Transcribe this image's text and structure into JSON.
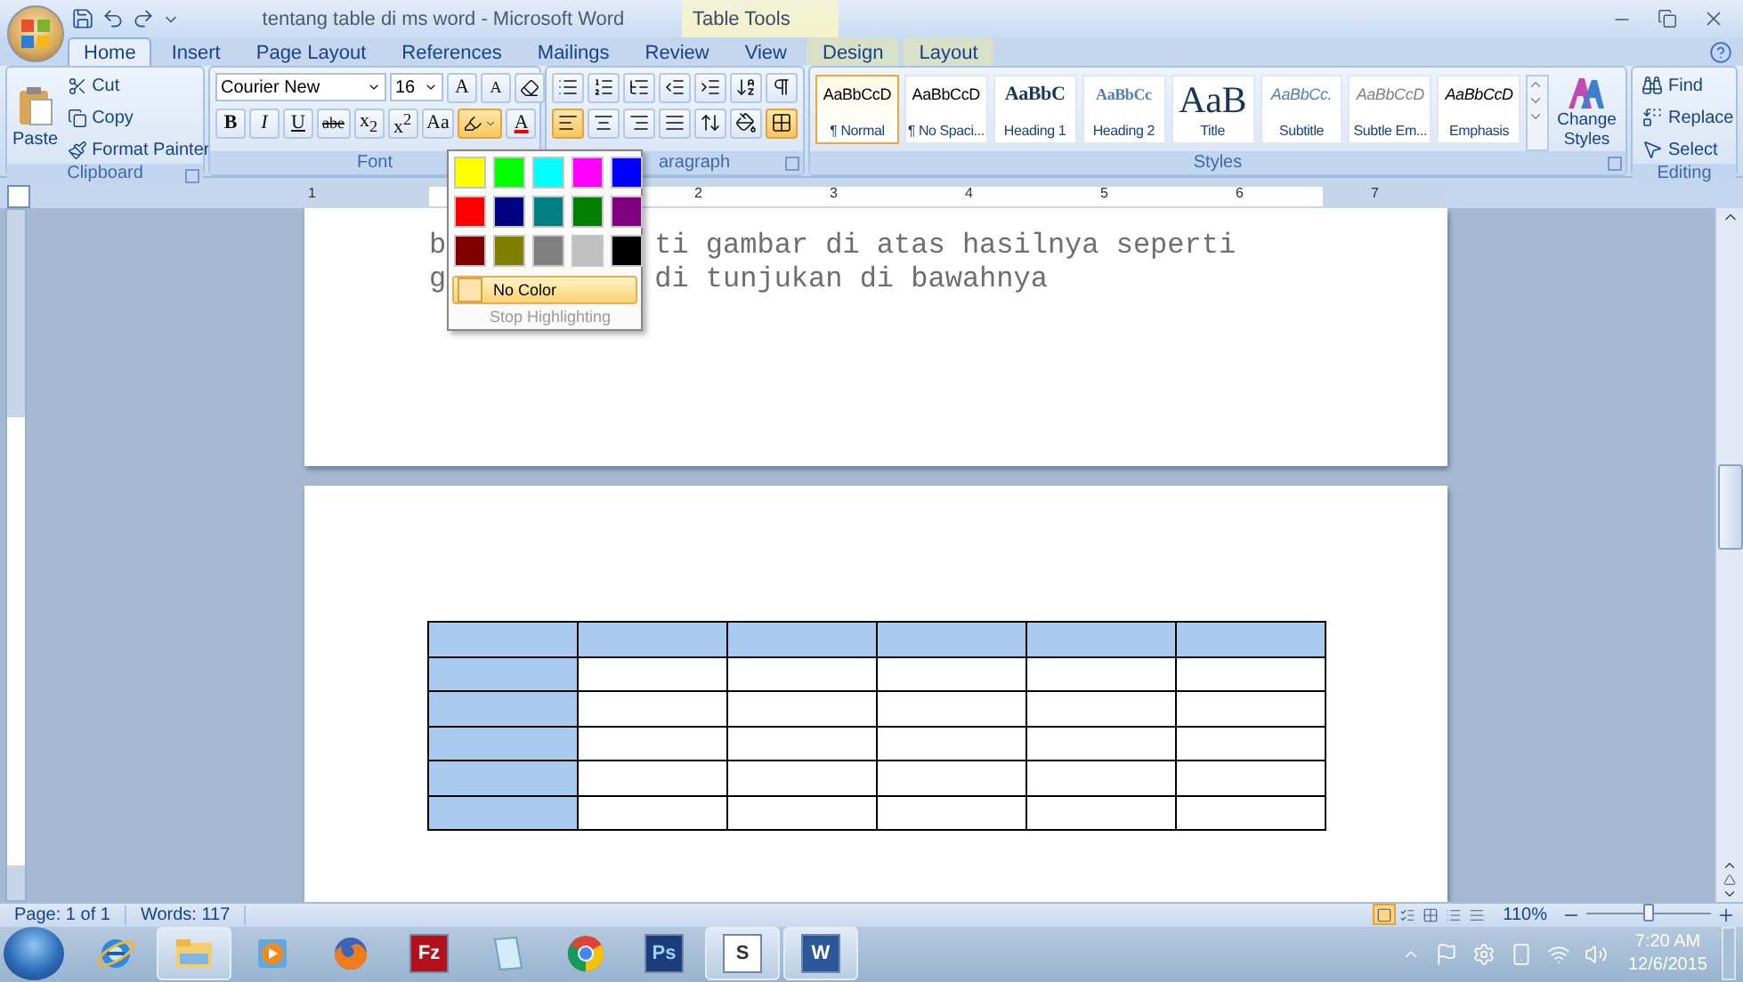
{
  "window": {
    "title": "tentang table di ms word - Microsoft Word",
    "context_title": "Table Tools"
  },
  "tabs": [
    {
      "label": "Home",
      "selected": true,
      "contextual": false
    },
    {
      "label": "Insert",
      "selected": false,
      "contextual": false
    },
    {
      "label": "Page Layout",
      "selected": false,
      "contextual": false
    },
    {
      "label": "References",
      "selected": false,
      "contextual": false
    },
    {
      "label": "Mailings",
      "selected": false,
      "contextual": false
    },
    {
      "label": "Review",
      "selected": false,
      "contextual": false
    },
    {
      "label": "View",
      "selected": false,
      "contextual": false
    },
    {
      "label": "Design",
      "selected": false,
      "contextual": true
    },
    {
      "label": "Layout",
      "selected": false,
      "contextual": true
    }
  ],
  "clipboard": {
    "label": "Clipboard",
    "paste": "Paste",
    "items": [
      {
        "kind": "cut",
        "label": "Cut"
      },
      {
        "kind": "copy",
        "label": "Copy"
      },
      {
        "kind": "painter",
        "label": "Format Painter"
      }
    ]
  },
  "font": {
    "label": "Font",
    "name": "Courier New",
    "size": "16",
    "grow": "A",
    "shrink": "A",
    "highlight_open": true,
    "format_buttons": [
      {
        "kind": "bold",
        "text": "B"
      },
      {
        "kind": "italic",
        "text": "I"
      },
      {
        "kind": "underline",
        "text": "U"
      },
      {
        "kind": "strike",
        "text": "abe"
      },
      {
        "kind": "sub",
        "text": "x$_{2}$"
      },
      {
        "kind": "sup",
        "text": "x$^{2}$"
      },
      {
        "kind": "case",
        "text": "Aa"
      }
    ],
    "color_text": "A"
  },
  "paragraph": {
    "label": "aragraph",
    "align": [
      {
        "kind": "left",
        "selected": true
      },
      {
        "kind": "center",
        "selected": false
      },
      {
        "kind": "right",
        "selected": false
      },
      {
        "kind": "justify",
        "selected": false
      }
    ],
    "borders_selected": true
  },
  "styles": {
    "label": "Styles",
    "change_label": "Change Styles",
    "items": [
      {
        "kind": "normal",
        "preview": "AaBbCcD",
        "label": "¶ Normal",
        "selected": true
      },
      {
        "kind": "normal",
        "preview": "AaBbCcD",
        "label": "¶ No Spaci...",
        "selected": false
      },
      {
        "kind": "heading1",
        "preview": "AaBbC",
        "label": "Heading 1",
        "selected": false
      },
      {
        "kind": "heading2",
        "preview": "AaBbCc",
        "label": "Heading 2",
        "selected": false
      },
      {
        "kind": "title",
        "preview": "AaB",
        "label": "Title",
        "selected": false
      },
      {
        "kind": "subtitle",
        "preview": "AaBbCc.",
        "label": "Subtitle",
        "selected": false
      },
      {
        "kind": "subtle",
        "preview": "AaBbCcD",
        "label": "Subtle Em...",
        "selected": false
      },
      {
        "kind": "emphasis",
        "preview": "AaBbCcD",
        "label": "Emphasis",
        "selected": false
      }
    ]
  },
  "editing": {
    "label": "Editing",
    "items": [
      {
        "kind": "find",
        "label": "Find"
      },
      {
        "kind": "replace",
        "label": "Replace"
      },
      {
        "kind": "select",
        "label": "Select"
      }
    ]
  },
  "highlight_menu": {
    "colors": [
      {
        "color": "#ffff00"
      },
      {
        "color": "#00ff00"
      },
      {
        "color": "#00ffff"
      },
      {
        "color": "#ff00ff"
      },
      {
        "color": "#0000ff"
      },
      {
        "color": "#ff0000"
      },
      {
        "color": "#000080"
      },
      {
        "color": "#008080"
      },
      {
        "color": "#008000"
      },
      {
        "color": "#800080"
      },
      {
        "color": "#800000"
      },
      {
        "color": "#808000"
      },
      {
        "color": "#808080"
      },
      {
        "color": "#c0c0c0"
      },
      {
        "color": "#000000"
      }
    ],
    "items": [
      {
        "label": "No Color",
        "selected": true,
        "disabled": false
      },
      {
        "label": "Stop Highlighting",
        "selected": false,
        "disabled": true
      }
    ]
  },
  "ruler": {
    "left_label": "1",
    "labels": [
      "2",
      "3",
      "4",
      "5",
      "6",
      "7"
    ]
  },
  "document": {
    "lines": [
      {
        "start": "b",
        "rest": "ti gambar di atas hasilnya seperti"
      },
      {
        "start": "g",
        "rest": "di tunjukan di bawahnya"
      }
    ],
    "table": {
      "rows": [
        {
          "cells": [
            {
              "shaded": true
            },
            {
              "shaded": true
            },
            {
              "shaded": true
            },
            {
              "shaded": true
            },
            {
              "shaded": true
            },
            {
              "shaded": true
            }
          ]
        },
        {
          "cells": [
            {
              "shaded": true
            },
            {
              "shaded": false
            },
            {
              "shaded": false
            },
            {
              "shaded": false
            },
            {
              "shaded": false
            },
            {
              "shaded": false
            }
          ]
        },
        {
          "cells": [
            {
              "shaded": true
            },
            {
              "shaded": false
            },
            {
              "shaded": false
            },
            {
              "shaded": false
            },
            {
              "shaded": false
            },
            {
              "shaded": false
            }
          ]
        },
        {
          "cells": [
            {
              "shaded": true
            },
            {
              "shaded": false
            },
            {
              "shaded": false
            },
            {
              "shaded": false
            },
            {
              "shaded": false
            },
            {
              "shaded": false
            }
          ]
        },
        {
          "cells": [
            {
              "shaded": true
            },
            {
              "shaded": false
            },
            {
              "shaded": false
            },
            {
              "shaded": false
            },
            {
              "shaded": false
            },
            {
              "shaded": false
            }
          ]
        },
        {
          "cells": [
            {
              "shaded": true
            },
            {
              "shaded": false
            },
            {
              "shaded": false
            },
            {
              "shaded": false
            },
            {
              "shaded": false
            },
            {
              "shaded": false
            }
          ]
        }
      ]
    }
  },
  "status_bar": {
    "page": "Page: 1 of 1",
    "words": "Words: 117",
    "zoom": "110%",
    "zoom_slider": {
      "level": 0.5
    },
    "views": [
      {
        "kind": "print",
        "selected": true
      },
      {
        "kind": "reading",
        "selected": false
      },
      {
        "kind": "web",
        "selected": false
      },
      {
        "kind": "outline",
        "selected": false
      },
      {
        "kind": "draft",
        "selected": false
      }
    ]
  },
  "taskbar": {
    "apps": [
      {
        "kind": "ie",
        "open": false
      },
      {
        "kind": "explorer",
        "open": true
      },
      {
        "kind": "media",
        "open": false
      },
      {
        "kind": "firefox",
        "open": false
      },
      {
        "kind": "filezilla",
        "open": false,
        "glyph": "Fz"
      },
      {
        "kind": "notepad",
        "open": false
      },
      {
        "kind": "chrome",
        "open": false
      },
      {
        "kind": "photoshop",
        "open": false,
        "glyph": "Ps"
      },
      {
        "kind": "slack",
        "open": true,
        "glyph": "S"
      },
      {
        "kind": "word",
        "open": true,
        "glyph": "W"
      }
    ],
    "clock": {
      "time": "7:20 AM",
      "date": "12/6/2015"
    }
  }
}
